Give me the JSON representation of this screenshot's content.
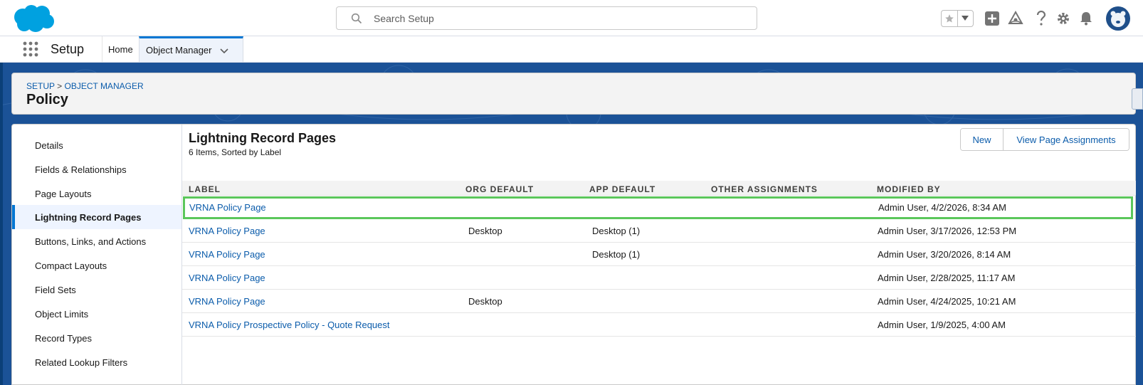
{
  "header": {
    "search_placeholder": "Search Setup",
    "icons": [
      "salesforce-cloud-logo",
      "search-icon",
      "star-icon",
      "chevron-down-icon",
      "plus-icon",
      "trailhead-icon",
      "help-icon",
      "gear-icon",
      "bell-icon",
      "avatar"
    ]
  },
  "context": {
    "app_name": "Setup",
    "tabs": [
      {
        "label": "Home"
      },
      {
        "label": "Object Manager"
      }
    ]
  },
  "page_header": {
    "breadcrumb_setup": "SETUP",
    "breadcrumb_sep": " > ",
    "breadcrumb_object_manager": "OBJECT MANAGER",
    "title": "Policy"
  },
  "sidebar": {
    "items": [
      {
        "label": "Details"
      },
      {
        "label": "Fields & Relationships"
      },
      {
        "label": "Page Layouts"
      },
      {
        "label": "Lightning Record Pages",
        "active": true
      },
      {
        "label": "Buttons, Links, and Actions"
      },
      {
        "label": "Compact Layouts"
      },
      {
        "label": "Field Sets"
      },
      {
        "label": "Object Limits"
      },
      {
        "label": "Record Types"
      },
      {
        "label": "Related Lookup Filters"
      }
    ]
  },
  "content": {
    "title": "Lightning Record Pages",
    "subtitle": "6 Items, Sorted by Label",
    "btn_new": "New",
    "btn_view_assignments": "View Page Assignments"
  },
  "table": {
    "columns": [
      "LABEL",
      "ORG DEFAULT",
      "APP DEFAULT",
      "OTHER ASSIGNMENTS",
      "MODIFIED BY"
    ],
    "rows": [
      {
        "label": "VRNA Policy Page",
        "org_default": "",
        "app_default": "",
        "other": "",
        "modified_by": "Admin User, 4/2/2026, 8:34 AM"
      },
      {
        "label": "VRNA Policy Page",
        "org_default": "Desktop",
        "app_default": "Desktop (1)",
        "other": "",
        "modified_by": "Admin User, 3/17/2026, 12:53 PM"
      },
      {
        "label": "VRNA Policy Page",
        "org_default": "",
        "app_default": "Desktop (1)",
        "other": "",
        "modified_by": "Admin User, 3/20/2026, 8:14 AM"
      },
      {
        "label": "VRNA Policy Page",
        "org_default": "",
        "app_default": "",
        "other": "",
        "modified_by": "Admin User, 2/28/2025, 11:17 AM"
      },
      {
        "label": "VRNA Policy Page",
        "org_default": "Desktop",
        "app_default": "",
        "other": "",
        "modified_by": "Admin User, 4/24/2025, 10:21 AM"
      },
      {
        "label": "VRNA Policy Prospective Policy - Quote Request",
        "org_default": "",
        "app_default": "",
        "other": "",
        "modified_by": "Admin User, 1/9/2025, 4:00 AM"
      }
    ]
  },
  "colors": {
    "brand_blue": "#0176d3",
    "link_blue": "#0b5cab",
    "background_band": "#1b5297",
    "highlight_green": "#5bc75b",
    "logo_blue": "#00a1e0"
  }
}
